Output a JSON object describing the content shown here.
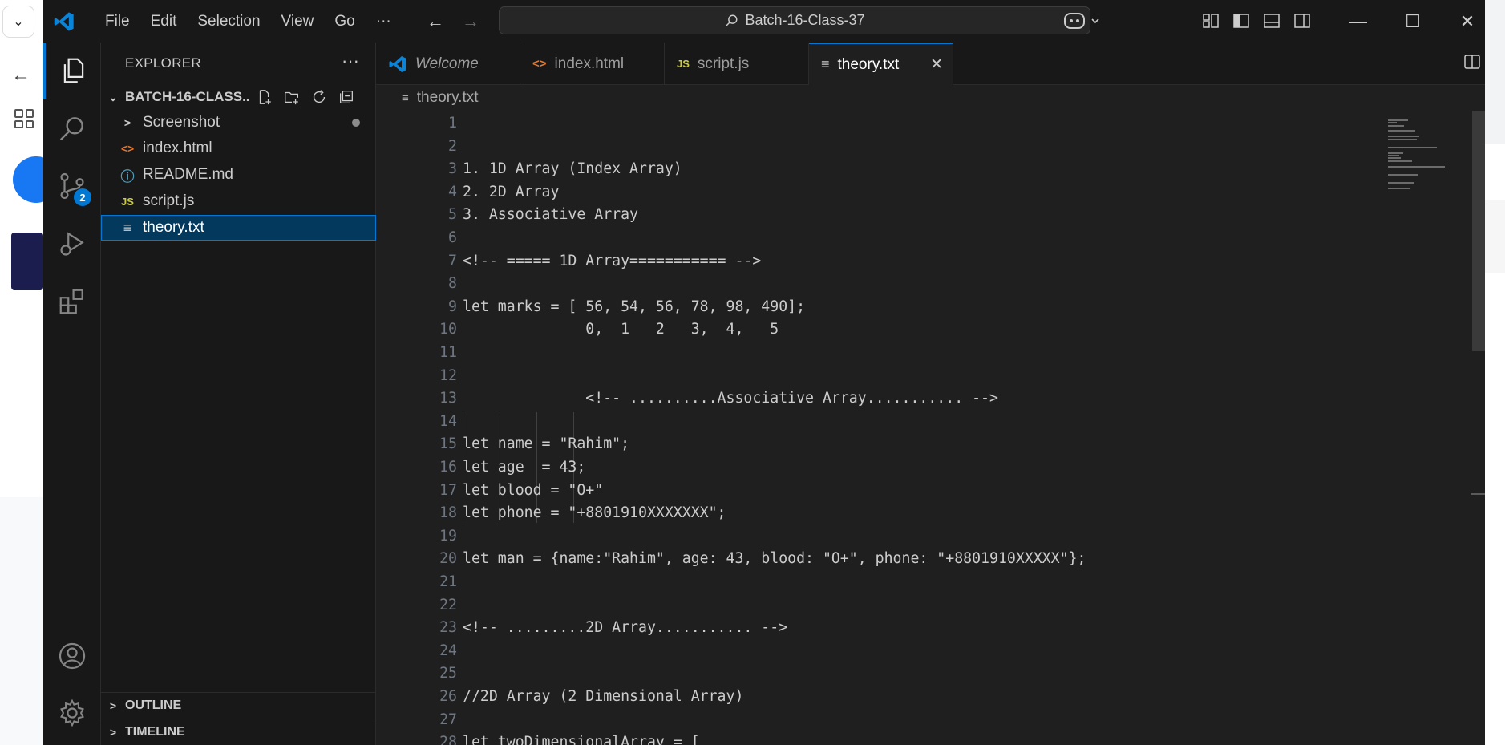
{
  "window": {
    "search_text": "Batch-16-Class-37",
    "menu": [
      "File",
      "Edit",
      "Selection",
      "View",
      "Go",
      "···"
    ]
  },
  "activity_bar": {
    "source_control_badge": "2"
  },
  "explorer": {
    "header": "EXPLORER",
    "more": "···",
    "folder_name": "BATCH-16-CLASS...",
    "items": [
      {
        "label": "Screenshot",
        "icon": ">",
        "type": "folder"
      },
      {
        "label": "index.html",
        "icon": "<>",
        "type": "html"
      },
      {
        "label": "README.md",
        "icon": "ⓘ",
        "type": "markdown"
      },
      {
        "label": "script.js",
        "icon": "JS",
        "type": "js"
      },
      {
        "label": "theory.txt",
        "icon": "≡",
        "type": "text"
      }
    ],
    "outline": "OUTLINE",
    "timeline": "TIMELINE"
  },
  "tabs": [
    {
      "label": "Welcome",
      "icon": "vscode-logo-icon"
    },
    {
      "label": "index.html",
      "icon": "<>"
    },
    {
      "label": "script.js",
      "icon": "JS"
    },
    {
      "label": "theory.txt",
      "icon": "≡",
      "close": "✕"
    }
  ],
  "breadcrumb": {
    "file": "theory.txt",
    "icon": "≡"
  },
  "editor": {
    "lines": [
      "",
      "",
      "1. 1D Array (Index Array)",
      "2. 2D Array",
      "3. Associative Array",
      "",
      "<!-- ===== 1D Array=========== -->",
      "",
      "let marks = [ 56, 54, 56, 78, 98, 490];",
      "              0,  1   2   3,  4,   5",
      "",
      "",
      "              <!-- ..........Associative Array........... -->",
      "",
      "let name = \"Rahim\";",
      "let age  = 43;",
      "let blood = \"O+\"",
      "let phone = \"+8801910XXXXXXX\";",
      "",
      "let man = {name:\"Rahim\", age: 43, blood: \"O+\", phone: \"+8801910XXXXX\"};",
      "",
      "",
      "<!-- .........2D Array........... -->",
      "",
      "",
      "//2D Array (2 Dimensional Array)",
      "",
      "let twoDimensionalArray = ["
    ]
  },
  "colors": {
    "accent": "#0078d4",
    "html_icon": "#e37933",
    "js_icon": "#cbcb41",
    "info_icon": "#519aba"
  }
}
